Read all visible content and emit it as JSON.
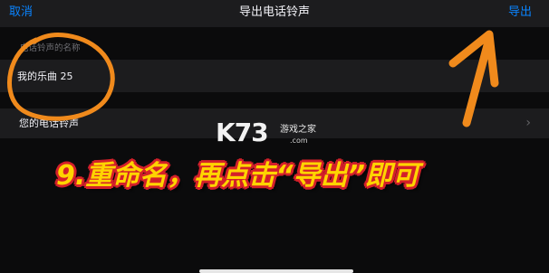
{
  "nav": {
    "cancel_label": "取消",
    "title": "导出电话铃声",
    "export_label": "导出"
  },
  "form": {
    "section_header": "电话铃声的名称",
    "name_value": "我的乐曲 25"
  },
  "list": {
    "ringtones_label": "您的电话铃声",
    "chevron": "›"
  },
  "watermark": {
    "logo": "K73",
    "site_name": "游戏之家",
    "domain": ".com"
  },
  "caption": {
    "text": "9.重命名，再点击“导出”即可"
  },
  "colors": {
    "accent": "#0a84ff",
    "background": "#0b0b0c",
    "cell": "#1c1c1e",
    "annotation_orange": "#f08a1c",
    "caption_fill": "#ffd400",
    "caption_outline": "#d4202a"
  }
}
